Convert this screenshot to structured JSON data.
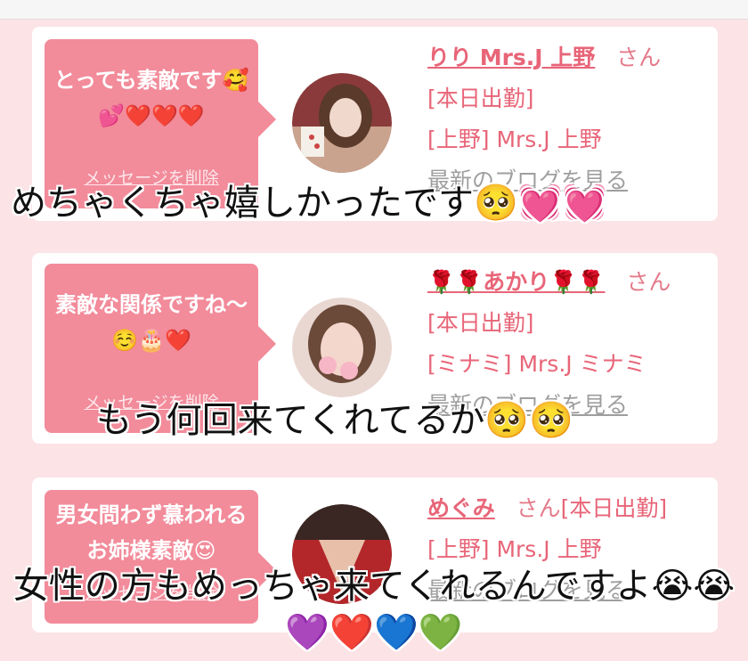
{
  "cards": [
    {
      "message": "とっても素敵です🥰💕❤️❤️❤️",
      "delete_label": "メッセージを削除",
      "name": "りり Mrs.J 上野",
      "suffix": "さん",
      "status": "[本日出勤]",
      "shop": "[上野] Mrs.J 上野",
      "blog_link": "最新のブログを見る"
    },
    {
      "message": "素敵な関係ですね〜☺️🎂❤️",
      "delete_label": "メッセージを削除",
      "name": "🌹🌹あかり🌹🌹",
      "suffix": "さん",
      "status": "[本日出勤]",
      "shop": "[ミナミ] Mrs.J ミナミ",
      "blog_link": "最新のブログを見る"
    },
    {
      "message": "男女問わず慕われるお姉様素敵😍",
      "delete_label": "メッセージを削除",
      "name": "めぐみ",
      "suffix": "さん",
      "status": "[本日出勤]",
      "shop": "[上野] Mrs.J 上野",
      "blog_link": "最新のブログを見る"
    }
  ],
  "captions": [
    "めちゃくちゃ嬉しかったです🥺💓💓",
    "もう何回来てくれてるか🥺🥺",
    "女性の方もめっちゃ来てくれるんですよ😭😭💜❤️💙💚"
  ],
  "colors": {
    "background": "#fbe3e6",
    "bubble": "#f28b9a",
    "name": "#e86578",
    "link_gray": "#9e9e9e"
  }
}
